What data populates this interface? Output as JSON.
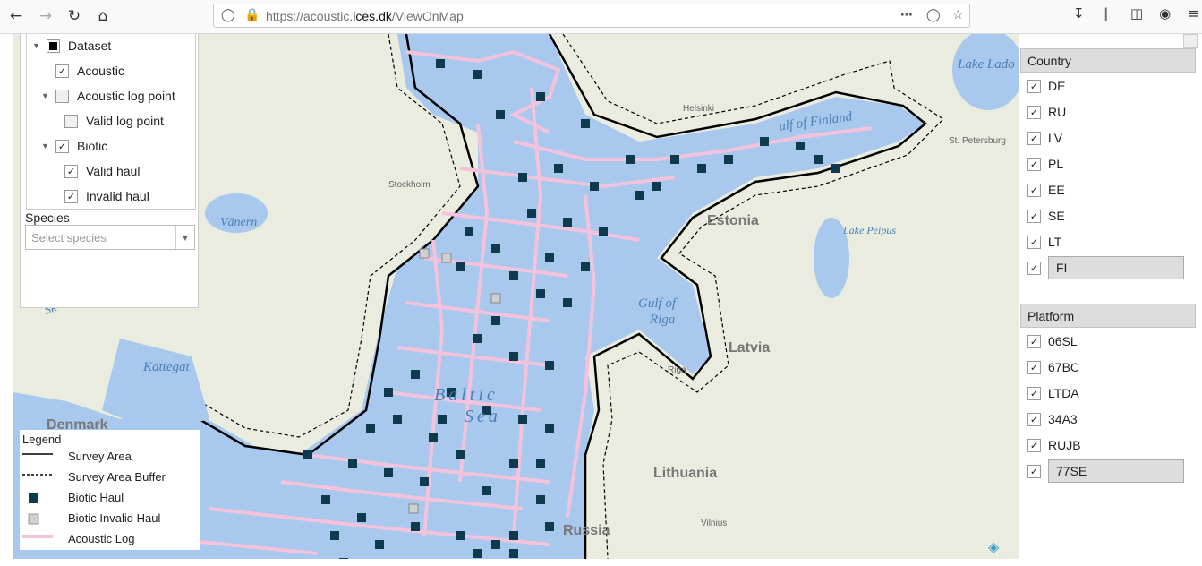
{
  "browser": {
    "url_prefix": "https://acoustic.",
    "url_domain": "ices.dk",
    "url_path": "/ViewOnMap"
  },
  "layer_tree": {
    "items": [
      {
        "label": "Dataset",
        "checked": "filled",
        "arrow": true,
        "indent": 0
      },
      {
        "label": "Acoustic",
        "checked": "check",
        "arrow": false,
        "indent": 1
      },
      {
        "label": "Acoustic log point",
        "checked": "empty",
        "arrow": true,
        "indent": 1
      },
      {
        "label": "Valid log point",
        "checked": "empty",
        "arrow": false,
        "indent": 2
      },
      {
        "label": "Biotic",
        "checked": "check",
        "arrow": true,
        "indent": 1
      },
      {
        "label": "Valid haul",
        "checked": "check",
        "arrow": false,
        "indent": 2
      },
      {
        "label": "Invalid haul",
        "checked": "check",
        "arrow": false,
        "indent": 2
      }
    ],
    "species_label": "Species",
    "species_placeholder": "Select species"
  },
  "legend": {
    "title": "Legend",
    "items": [
      {
        "label": "Survey Area",
        "symbol": "solid-line"
      },
      {
        "label": "Survey Area Buffer",
        "symbol": "dashed-line"
      },
      {
        "label": "Biotic Haul",
        "symbol": "dark-square"
      },
      {
        "label": "Biotic Invalid Haul",
        "symbol": "grey-square"
      },
      {
        "label": "Acoustic Log",
        "symbol": "pink-line"
      }
    ]
  },
  "country_filter": {
    "title": "Country",
    "items": [
      "DE",
      "RU",
      "LV",
      "PL",
      "EE",
      "SE",
      "LT",
      "FI"
    ],
    "selected": "FI"
  },
  "platform_filter": {
    "title": "Platform",
    "items": [
      "06SL",
      "67BC",
      "LTDA",
      "34A3",
      "RUJB",
      "77SE"
    ],
    "selected": "77SE"
  },
  "map_labels": {
    "lake_ladoga": "Lake Lado",
    "gulf_of_finland": "ulf of Finland",
    "st_petersburg": "St. Petersburg",
    "helsinki": "Helsinki",
    "stockholm": "Stockholm",
    "estonia": "Estonia",
    "lake_peipus": "Lake Peipus",
    "vanern": "Vänern",
    "gulf_of_riga_1": "Gulf of",
    "gulf_of_riga_2": "Riga",
    "latvia": "Latvia",
    "kattegat": "Kattegat",
    "baltic_1": "Baltic",
    "baltic_2": "Sea",
    "denmark": "Denmark",
    "lithuania": "Lithuania",
    "russia": "Russia",
    "vilnius": "Vilnius",
    "riga_city": "Riga",
    "skagerrak": "Sk"
  },
  "colors": {
    "water": "#a8c8ee",
    "land": "#e9ecdf",
    "haul": "#0e3a4e",
    "invalid_haul": "#d0d0d0",
    "acoustic_log": "#f5c2dc"
  }
}
